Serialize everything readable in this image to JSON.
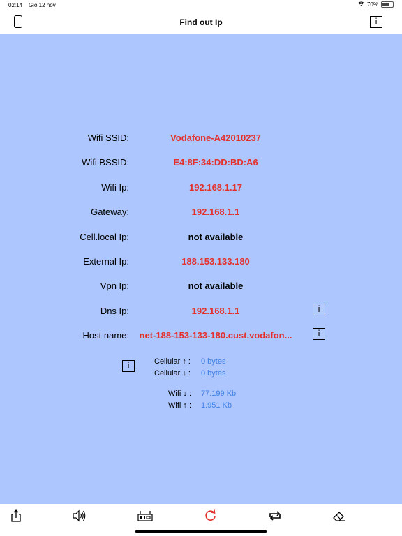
{
  "status": {
    "time": "02:14",
    "date": "Gio 12 nov",
    "battery": "70%"
  },
  "nav": {
    "title": "Find out Ip",
    "info_label": "i"
  },
  "rows": [
    {
      "label": "Wifi SSID:",
      "value": "Vodafone-A42010237"
    },
    {
      "label": "Wifi BSSID:",
      "value": "E4:8F:34:DD:BD:A6"
    },
    {
      "label": "Wifi Ip:",
      "value": "192.168.1.17"
    },
    {
      "label": "Gateway:",
      "value": "192.168.1.1"
    },
    {
      "label": "Cell.local Ip:",
      "value": "not available"
    },
    {
      "label": "External Ip:",
      "value": "188.153.133.180"
    },
    {
      "label": "Vpn Ip:",
      "value": "not available"
    },
    {
      "label": "Dns Ip:",
      "value": "192.168.1.1"
    },
    {
      "label": "Host name:",
      "value": "net-188-153-133-180.cust.vodafon..."
    }
  ],
  "info_label": "i",
  "traffic": {
    "cellular_up_label": "Cellular ↑ :",
    "cellular_up_value": "0 bytes",
    "cellular_down_label": "Cellular ↓ :",
    "cellular_down_value": "0 bytes",
    "wifi_down_label": "Wifi ↓ :",
    "wifi_down_value": "77.199 Kb",
    "wifi_up_label": "Wifi ↑ :",
    "wifi_up_value": "1.951 Kb"
  },
  "colors": {
    "background": "#adc6fd",
    "value_red": "#e4312c",
    "traffic_blue": "#3d7ee6"
  },
  "toolbar_icons": [
    "share-icon",
    "speaker-icon",
    "router-icon",
    "refresh-icon",
    "repeat-icon",
    "eraser-icon"
  ]
}
